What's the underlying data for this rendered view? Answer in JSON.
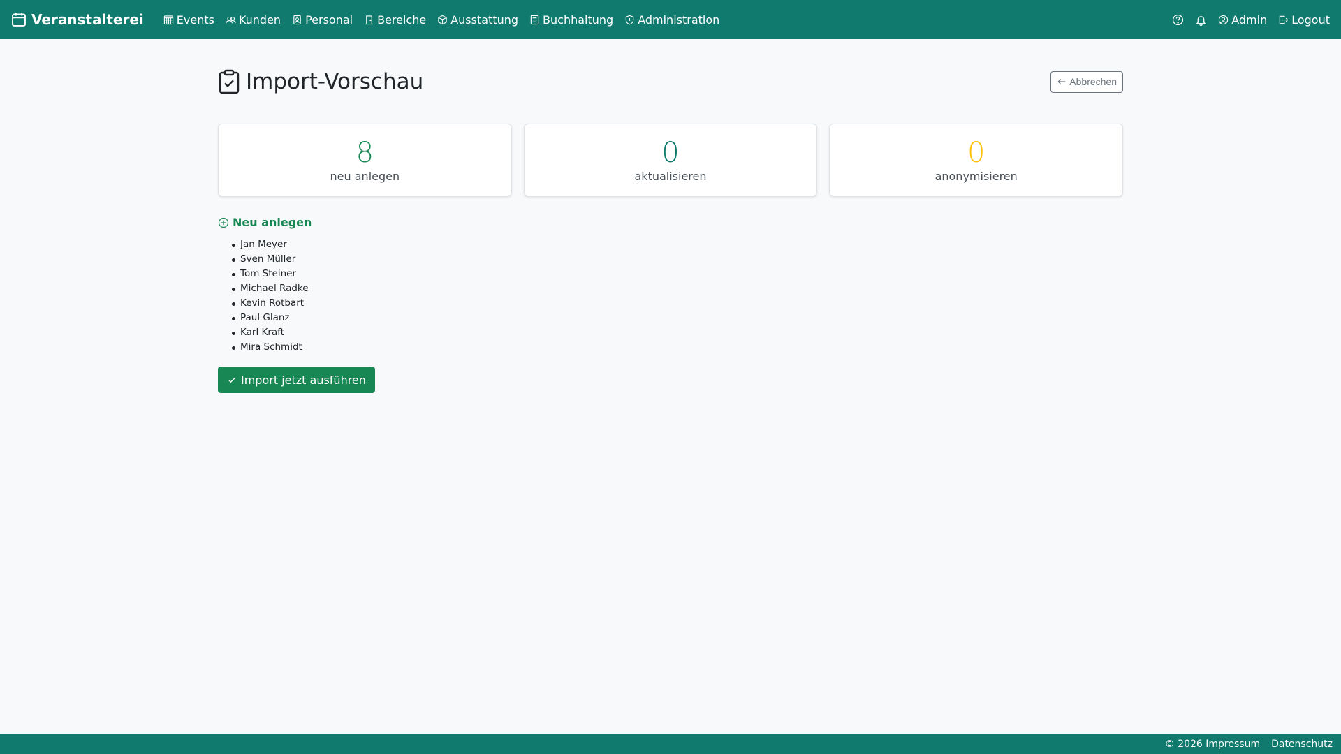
{
  "navbar": {
    "brand": "Veranstalterei",
    "items": [
      {
        "label": "Events",
        "icon": "calendar-grid-icon"
      },
      {
        "label": "Kunden",
        "icon": "people-icon"
      },
      {
        "label": "Personal",
        "icon": "person-badge-icon"
      },
      {
        "label": "Bereiche",
        "icon": "door-icon"
      },
      {
        "label": "Ausstattung",
        "icon": "box-icon"
      },
      {
        "label": "Buchhaltung",
        "icon": "ledger-icon"
      },
      {
        "label": "Administration",
        "icon": "shield-icon"
      }
    ],
    "right": {
      "help_icon": "question-circle-icon",
      "notifications_icon": "bell-icon",
      "user_label": "Admin",
      "logout_label": "Logout"
    },
    "color": "#0f7a6d"
  },
  "page": {
    "title": "Import-Vorschau",
    "title_icon": "clipboard-check-icon",
    "cancel_label": "Abbrechen"
  },
  "stats": [
    {
      "value": "8",
      "label": "neu anlegen",
      "color": "#198754"
    },
    {
      "value": "0",
      "label": "aktualisieren",
      "color": "#0f7a6d"
    },
    {
      "value": "0",
      "label": "anonymisieren",
      "color": "#ffc107"
    }
  ],
  "new_section": {
    "heading": "Neu anlegen",
    "names": [
      "Jan Meyer",
      "Sven Müller",
      "Tom Steiner",
      "Michael Radke",
      "Kevin Rotbart",
      "Paul Glanz",
      "Karl Kraft",
      "Mira Schmidt"
    ]
  },
  "import_button": "Import jetzt ausführen",
  "footer": {
    "impressum": "© 2026 Impressum",
    "datenschutz": "Datenschutz"
  }
}
